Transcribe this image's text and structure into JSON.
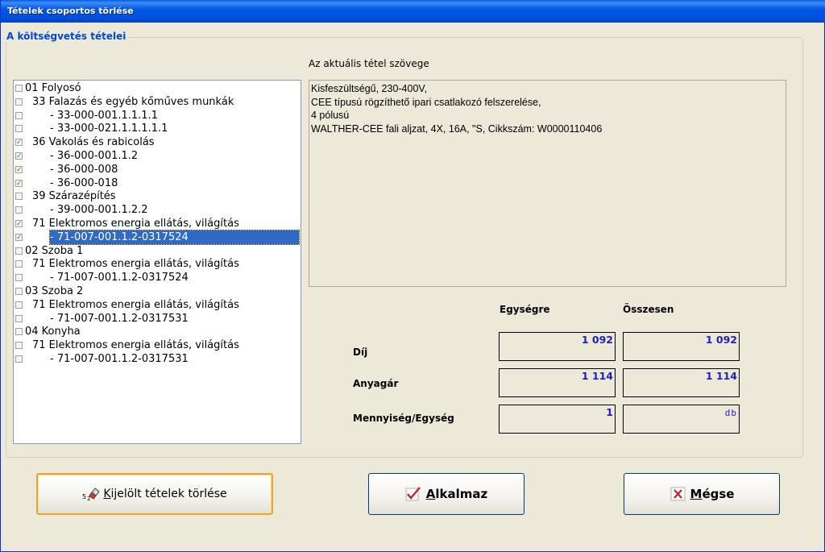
{
  "window": {
    "title": "Tételek csoportos törlése"
  },
  "group": {
    "legend": "A költségvetés tételei"
  },
  "tree": {
    "items": [
      {
        "label": "01 Folyosó",
        "indent": 0,
        "checked": false,
        "selected": false
      },
      {
        "label": "33 Falazás és egyéb kőműves munkák",
        "indent": 1,
        "checked": false,
        "selected": false
      },
      {
        "label": "- 33-000-001.1.1.1.1",
        "indent": 2,
        "checked": false,
        "selected": false
      },
      {
        "label": "- 33-000-021.1.1.1.1.1",
        "indent": 2,
        "checked": false,
        "selected": false
      },
      {
        "label": "36 Vakolás és rabicolás",
        "indent": 1,
        "checked": true,
        "selected": false
      },
      {
        "label": "- 36-000-001.1.2",
        "indent": 2,
        "checked": true,
        "selected": false
      },
      {
        "label": "- 36-000-008",
        "indent": 2,
        "checked": true,
        "selected": false
      },
      {
        "label": "- 36-000-018",
        "indent": 2,
        "checked": true,
        "selected": false
      },
      {
        "label": "39 Szárazépítés",
        "indent": 1,
        "checked": false,
        "selected": false
      },
      {
        "label": "- 39-000-001.1.2.2",
        "indent": 2,
        "checked": false,
        "selected": false
      },
      {
        "label": "71 Elektromos energia ellátás, világítás",
        "indent": 1,
        "checked": true,
        "selected": false
      },
      {
        "label": "- 71-007-001.1.2-0317524",
        "indent": 2,
        "checked": true,
        "selected": true
      },
      {
        "label": "02 Szoba 1",
        "indent": 0,
        "checked": false,
        "selected": false
      },
      {
        "label": "71 Elektromos energia ellátás, világítás",
        "indent": 1,
        "checked": false,
        "selected": false
      },
      {
        "label": "- 71-007-001.1.2-0317524",
        "indent": 2,
        "checked": false,
        "selected": false
      },
      {
        "label": "03 Szoba 2",
        "indent": 0,
        "checked": false,
        "selected": false
      },
      {
        "label": "71 Elektromos energia ellátás, világítás",
        "indent": 1,
        "checked": false,
        "selected": false
      },
      {
        "label": "- 71-007-001.1.2-0317531",
        "indent": 2,
        "checked": false,
        "selected": false
      },
      {
        "label": "04 Konyha",
        "indent": 0,
        "checked": false,
        "selected": false
      },
      {
        "label": "71 Elektromos energia ellátás, világítás",
        "indent": 1,
        "checked": false,
        "selected": false
      },
      {
        "label": "- 71-007-001.1.2-0317531",
        "indent": 2,
        "checked": false,
        "selected": false
      }
    ]
  },
  "detail": {
    "heading": "Az aktuális tétel szövege",
    "lines": [
      "Kisfeszültségű, 230-400V,",
      "CEE típusú rögzíthető ipari csatlakozó felszerelése,",
      "4 pólusú",
      "WALTHER-CEE fali aljzat, 4X, 16A, \"S, Cikkszám: W0000110406"
    ]
  },
  "values": {
    "col_unit": "Egységre",
    "col_total": "Összesen",
    "fee_label": "Díj",
    "material_label": "Anyagár",
    "qty_label": "Mennyiség/Egység",
    "fee_unit": "1 092",
    "fee_total": "1 092",
    "material_unit": "1 114",
    "material_total": "1 114",
    "qty_value": "1",
    "qty_unit": "db"
  },
  "buttons": {
    "delete": {
      "label_pre": "",
      "label_key": "K",
      "label_rest": "ijelölt tételek törlése",
      "icon": "eraser-icon"
    },
    "apply": {
      "label_key": "A",
      "label_rest": "lkalmaz",
      "icon": "checkmark-icon"
    },
    "cancel": {
      "label_key": "M",
      "label_rest": "égse",
      "icon": "cross-icon"
    }
  },
  "colors": {
    "title_bar": "#0058e6",
    "legend_text": "#0046d5",
    "value_text": "#2020c0",
    "selection": "#316ac5",
    "checkbox_check": "#21a121"
  }
}
